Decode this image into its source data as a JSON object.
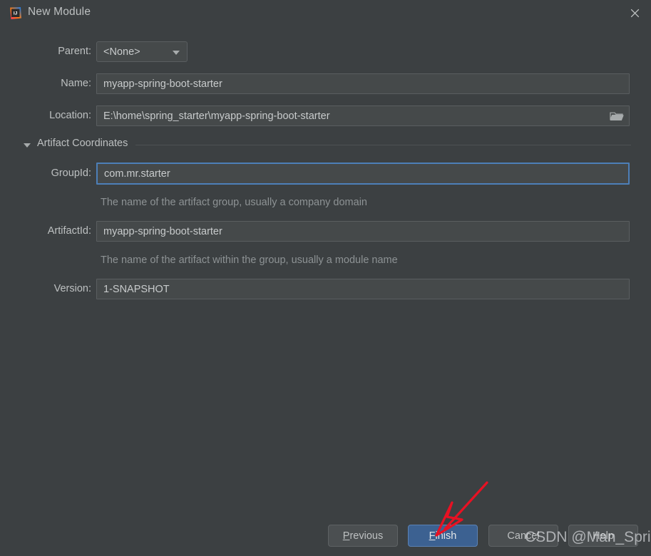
{
  "window": {
    "title": "New Module",
    "app_icon": "intellij-idea-icon",
    "close_label": "×",
    "background_color": "#3c4042"
  },
  "form": {
    "parent": {
      "label": "Parent:",
      "value": "<None>",
      "caret_icon": "chevron-down-icon"
    },
    "name": {
      "label": "Name:",
      "value": "myapp-spring-boot-starter"
    },
    "location": {
      "label": "Location:",
      "value": "E:\\home\\spring_starter\\myapp-spring-boot-starter",
      "browse_icon": "folder-icon"
    }
  },
  "artifact_section": {
    "title": "Artifact Coordinates",
    "expanded": true,
    "toggle_icon": "triangle-down-icon",
    "fields": {
      "group_id": {
        "label": "GroupId:",
        "value": "com.mr.starter",
        "hint": "The name of the artifact group, usually a company domain",
        "focused": true,
        "focus_color": "#4d7fb8"
      },
      "artifact_id": {
        "label": "ArtifactId:",
        "value": "myapp-spring-boot-starter",
        "hint": "The name of the artifact within the group, usually a module name",
        "focused": false
      },
      "version": {
        "label": "Version:",
        "value": "1-SNAPSHOT",
        "focused": false
      }
    }
  },
  "buttons": {
    "previous": {
      "label": "Previous",
      "mnemonic": "P",
      "default": false
    },
    "finish": {
      "label": "Finish",
      "mnemonic": "F",
      "default": true,
      "accent_color": "#3c6191"
    },
    "cancel": {
      "label": "Cancel",
      "mnemonic": "",
      "default": false
    },
    "help": {
      "label": "Help",
      "mnemonic": "",
      "default": false
    }
  },
  "annotations": {
    "arrow": {
      "name": "red-arrow-annotation",
      "color": "#e81123",
      "points_to": "finish-button"
    },
    "watermark": "CSDN @Man_Spring"
  }
}
